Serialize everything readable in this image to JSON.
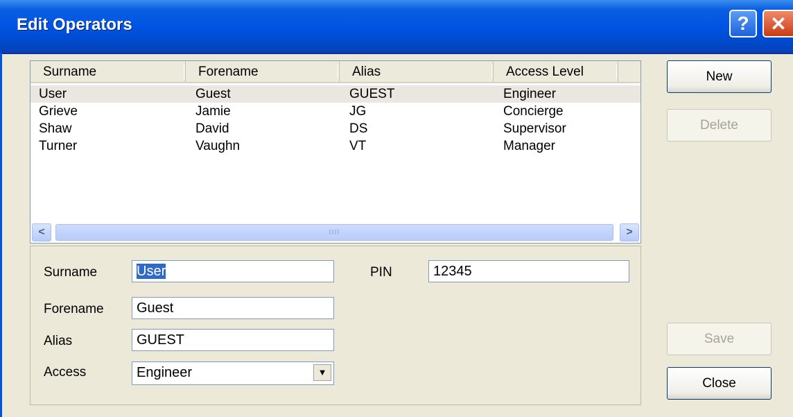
{
  "window": {
    "title": "Edit Operators",
    "help_glyph": "?",
    "close_glyph": "✕"
  },
  "list": {
    "columns": [
      "Surname",
      "Forename",
      "Alias",
      "Access Level"
    ],
    "rows": [
      {
        "surname": "User",
        "forename": "Guest",
        "alias": "GUEST",
        "access": "Engineer"
      },
      {
        "surname": "Grieve",
        "forename": "Jamie",
        "alias": "JG",
        "access": "Concierge"
      },
      {
        "surname": "Shaw",
        "forename": "David",
        "alias": "DS",
        "access": "Supervisor"
      },
      {
        "surname": "Turner",
        "forename": "Vaughn",
        "alias": "VT",
        "access": "Manager"
      }
    ],
    "selected_row": 0
  },
  "form": {
    "surname_label": "Surname",
    "surname_value": "User",
    "forename_label": "Forename",
    "forename_value": "Guest",
    "alias_label": "Alias",
    "alias_value": "GUEST",
    "access_label": "Access",
    "access_value": "Engineer",
    "pin_label": "PIN",
    "pin_value": "12345"
  },
  "buttons": {
    "new": "New",
    "delete": "Delete",
    "save": "Save",
    "close": "Close"
  },
  "scrollbar": {
    "left_glyph": "<",
    "right_glyph": ">",
    "grip": "IIII"
  },
  "colors": {
    "titlebar": "#0054e3",
    "selection": "#316ac5",
    "dialog_bg": "#ece9d8"
  }
}
